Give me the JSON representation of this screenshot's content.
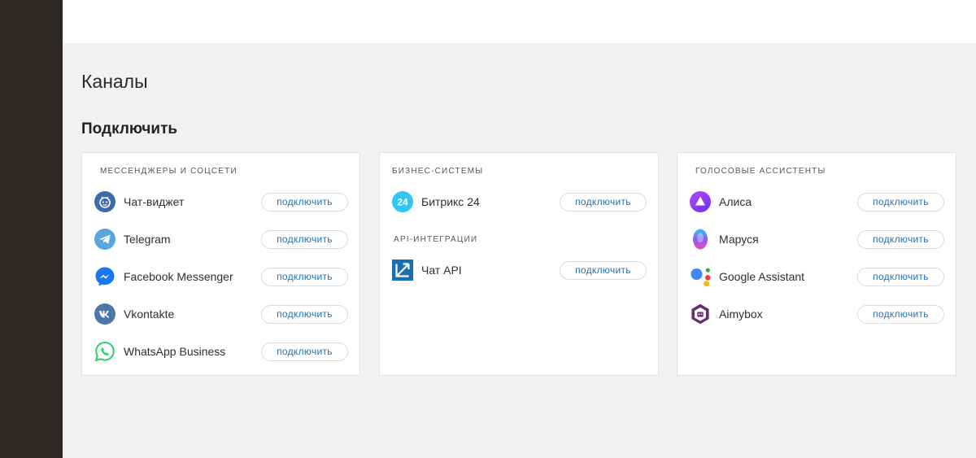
{
  "page": {
    "title": "Каналы",
    "section": "Подключить"
  },
  "connect_label": "подключить",
  "cards": [
    {
      "groups": [
        {
          "label": "МЕССЕНДЖЕРЫ И СОЦСЕТИ",
          "items": [
            {
              "name": "Чат-виджет",
              "icon": "chat-widget-icon"
            },
            {
              "name": "Telegram",
              "icon": "telegram-icon"
            },
            {
              "name": "Facebook Messenger",
              "icon": "messenger-icon"
            },
            {
              "name": "Vkontakte",
              "icon": "vk-icon"
            },
            {
              "name": "WhatsApp Business",
              "icon": "whatsapp-icon"
            }
          ]
        }
      ]
    },
    {
      "groups": [
        {
          "label": "БИЗНЕС-СИСТЕМЫ",
          "items": [
            {
              "name": "Битрикс 24",
              "icon": "bitrix24-icon"
            }
          ]
        },
        {
          "label": "API-ИНТЕГРАЦИИ",
          "items": [
            {
              "name": "Чат API",
              "icon": "chat-api-icon"
            }
          ]
        }
      ]
    },
    {
      "groups": [
        {
          "label": "ГОЛОСОВЫЕ АССИСТЕНТЫ",
          "items": [
            {
              "name": "Алиса",
              "icon": "alice-icon"
            },
            {
              "name": "Маруся",
              "icon": "marusya-icon"
            },
            {
              "name": "Google Assistant",
              "icon": "google-assistant-icon"
            },
            {
              "name": "Aimybox",
              "icon": "aimybox-icon"
            }
          ]
        }
      ]
    }
  ],
  "colors": {
    "sidebar": "#2a2724",
    "accent": "#1f72b8",
    "telegram": "#5aa7de",
    "messenger": "#1877f2",
    "vk": "#4a76a8",
    "whatsapp": "#25d366",
    "bitrix": "#2fc6f6",
    "alice": "#8a3ffc"
  }
}
